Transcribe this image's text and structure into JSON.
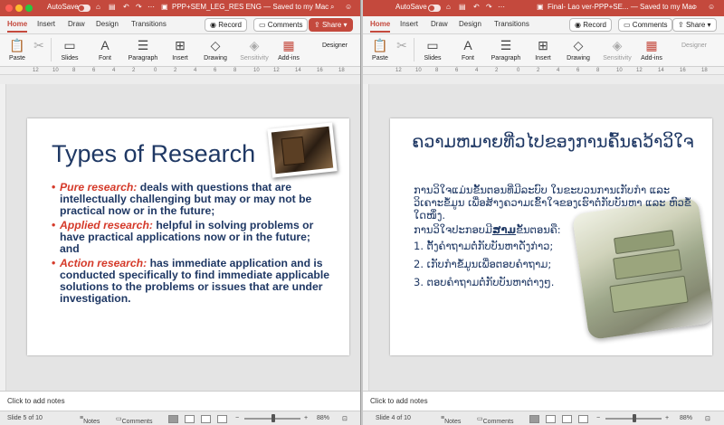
{
  "left": {
    "autosave_label": "AutoSave",
    "doc_title": "PPP+SEM_LEG_RES ENG — Saved to my Mac",
    "tabs": [
      "Home",
      "Insert",
      "Draw",
      "Design",
      "Transitions"
    ],
    "record_label": "Record",
    "comments_label": "Comments",
    "share_label": "Share",
    "ribbon": {
      "paste": "Paste",
      "slides": "Slides",
      "font": "Font",
      "paragraph": "Paragraph",
      "insert": "Insert",
      "drawing": "Drawing",
      "sensitivity": "Sensitivity",
      "addins": "Add-ins",
      "designer": "Designer"
    },
    "slide": {
      "title": "Types of Research",
      "bullets": [
        {
          "key": "Pure research:",
          "text": " deals with questions that are intellectually challenging but may or may not be practical now or in the future;"
        },
        {
          "key": "Applied research:",
          "text": " helpful in solving problems or have practical applications now or in the future; and"
        },
        {
          "key": "Action research:",
          "text": " has immediate application and is conducted specifically to find immediate applicable solutions to the problems or issues that are under investigation."
        }
      ]
    },
    "notes_placeholder": "Click to add notes",
    "status": {
      "slide_info": "Slide 5 of 10",
      "notes_label": "Notes",
      "comments_label": "Comments",
      "zoom": "88%"
    }
  },
  "right": {
    "autosave_label": "AutoSave",
    "doc_title": "Final- Lao ver-PPP+SE... — Saved to my Mac",
    "tabs": [
      "Home",
      "Insert",
      "Draw",
      "Design",
      "Transitions"
    ],
    "record_label": "Record",
    "comments_label": "Comments",
    "share_label": "Share",
    "ribbon": {
      "paste": "Paste",
      "slides": "Slides",
      "font": "Font",
      "paragraph": "Paragraph",
      "insert": "Insert",
      "drawing": "Drawing",
      "sensitivity": "Sensitivity",
      "addins": "Add-ins",
      "designer": "Designer"
    },
    "slide": {
      "title": "ຄວາມຫມາຍທີ່ວໄປຂອງການຄົ້ນຄວ້າວິໃຈ",
      "para1": "ການວິໃຈແມ່ນຂັ້ນຕອນທີ່ມີລະບົບ ໃນຂະບວນການເກັບກໍາ ແລະ ວິເຄາະຂໍ້ມູນ ເພື່ອສ້າງຄວາມເຂົ້າໃຈຂອງເຮົາຕໍ່ກັບບັນຫາ ແລະ ຫົວຂໍ້ໃດໜຶ່ງ.",
      "para2_prefix": "ການວິໃຈປະກອບມີ",
      "para2_emph": "ສາມ",
      "para2_suffix": "ຂັ້ນຕອນຄື:",
      "steps": [
        "1.  ຕັ້ງຄໍາຖາມຕໍ່ກັບບັນຫາດັ່ງກ່າວ;",
        "2.  ເກັບກໍາຂໍ້ມູນເພື່ອຕອບຄໍາຖາມ;",
        "3.  ຕອບຄໍາຖາມຕໍ່ກັບບັນຫາຕ່າງໆ."
      ]
    },
    "notes_placeholder": "Click to add notes",
    "status": {
      "slide_info": "Slide 4 of 10",
      "notes_label": "Notes",
      "comments_label": "Comments",
      "zoom": "88%"
    }
  }
}
